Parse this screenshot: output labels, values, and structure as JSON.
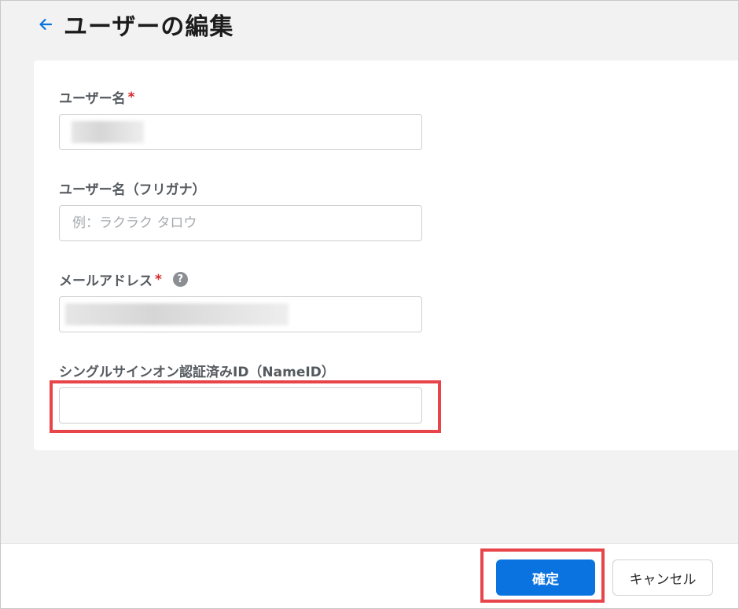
{
  "header": {
    "title": "ユーザーの編集",
    "back_icon": "arrow-left-icon"
  },
  "colors": {
    "accent": "#0b73e0",
    "required": "#d8262a",
    "highlight": "#e8454a"
  },
  "form": {
    "username": {
      "label": "ユーザー名",
      "required_mark": "*",
      "value": ""
    },
    "username_kana": {
      "label": "ユーザー名（フリガナ）",
      "placeholder": "例：ラクラク タロウ",
      "value": ""
    },
    "email": {
      "label": "メールアドレス",
      "required_mark": "*",
      "help_icon": "question-circle-icon",
      "help_glyph": "?",
      "value": ""
    },
    "sso_nameid": {
      "label": "シングルサインオン認証済みID（NameID）",
      "value": ""
    }
  },
  "footer": {
    "confirm_label": "確定",
    "cancel_label": "キャンセル"
  }
}
